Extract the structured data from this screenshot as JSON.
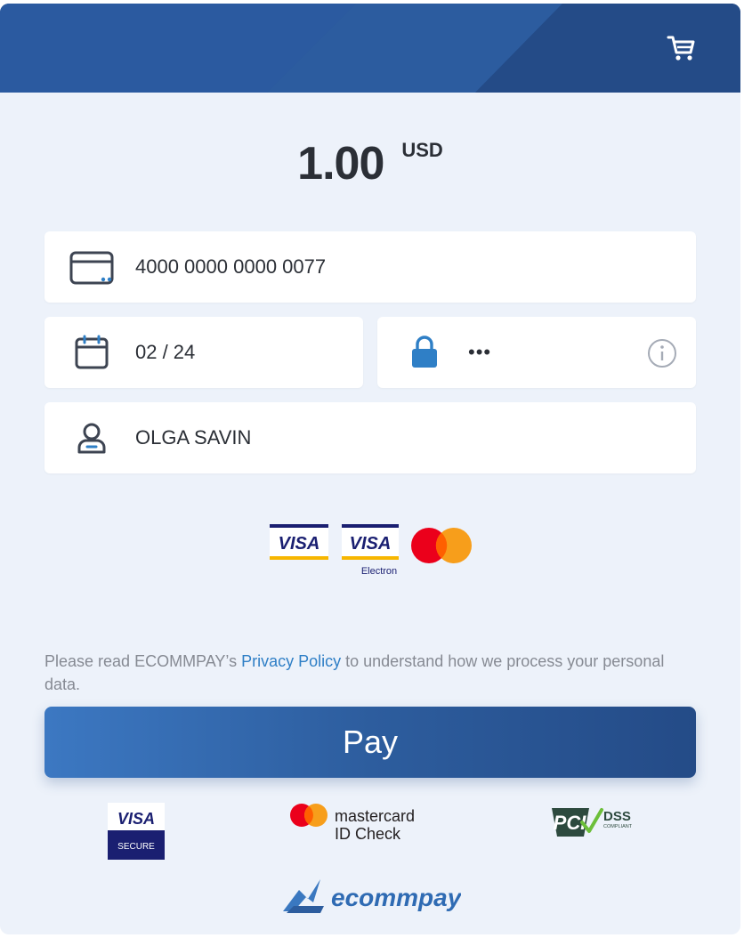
{
  "amount": {
    "value": "1.00",
    "currency": "USD"
  },
  "card": {
    "number": "4000 0000 0000 0077",
    "expiry": "02 / 24",
    "cvv": "•••",
    "holder": "OLGA SAVIN"
  },
  "icons": {
    "cart": "shopping-cart-icon",
    "card": "credit-card-icon",
    "calendar": "calendar-icon",
    "lock": "lock-icon",
    "info": "info-icon",
    "user": "user-icon"
  },
  "brands": {
    "visa": "VISA",
    "visa_electron": "VISA",
    "visa_electron_sub": "Electron"
  },
  "policy": {
    "prefix": "Please read ECOMMPAY’s ",
    "link": "Privacy Policy",
    "suffix": " to understand how we process your personal data."
  },
  "pay_label": "Pay",
  "trust": {
    "visa_secure_top": "VISA",
    "visa_secure_bottom": "SECURE",
    "mc_name": "mastercard",
    "mc_sub": "ID Check",
    "pci": "PCI",
    "dss": "DSS",
    "dss_sub": "COMPLIANT"
  },
  "footer_logo": "ecommpay",
  "colors": {
    "header": "#24508f",
    "accent": "#2f7fc6",
    "pay_start": "#3c78c2",
    "pay_end": "#244b87",
    "background": "#edf2fa"
  }
}
